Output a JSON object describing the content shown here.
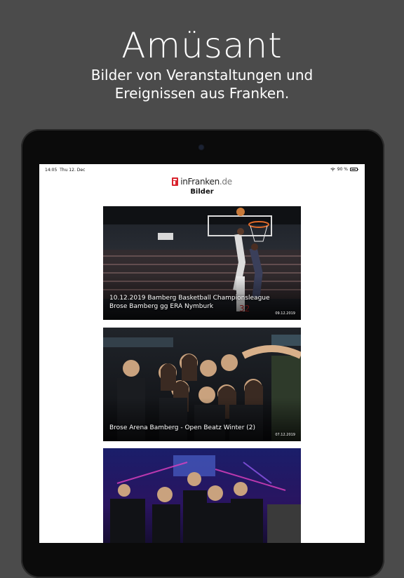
{
  "promo": {
    "headline": "Amüsant",
    "subline_1": "Bilder von Veranstaltungen und",
    "subline_2": "Ereignissen aus Franken."
  },
  "statusbar": {
    "time": "14:05",
    "date": "Thu 12. Dec",
    "battery": "90 %",
    "battery_level": 0.9
  },
  "app": {
    "logo_main": "inFranken",
    "logo_tld": ".de",
    "page_title": "Bilder"
  },
  "gallery": [
    {
      "title_1": "10.12.2019 Bamberg Basketball Championsleague",
      "title_2": "Brose Bamberg gg ERA Nymburk",
      "date": "09.12.2019"
    },
    {
      "title_1": "Brose Arena Bamberg - Open Beatz Winter (2)",
      "title_2": "",
      "date": "07.12.2019"
    },
    {
      "title_1": "",
      "title_2": "",
      "date": ""
    }
  ],
  "colors": {
    "background": "#4b4b4b",
    "brand_red": "#d9232d"
  }
}
